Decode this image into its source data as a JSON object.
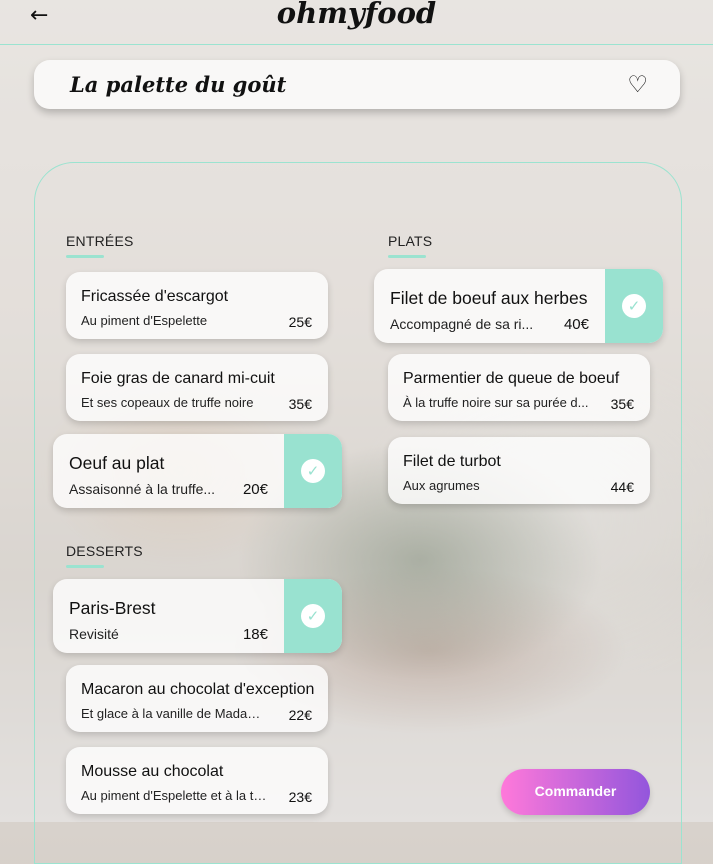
{
  "header": {
    "back_icon": "arrow-left-icon",
    "logo": "ohmyfood"
  },
  "restaurant": {
    "title": "La palette du goût",
    "favorite_icon": "heart-outline-icon"
  },
  "sections": {
    "starters": {
      "label": "ENTRÉES",
      "items": [
        {
          "name": "Fricassée d'escargot",
          "description": "Au piment d'Espelette",
          "price": "25€",
          "selected": false
        },
        {
          "name": "Foie gras de canard mi-cuit",
          "description": "Et ses copeaux de truffe noire",
          "price": "35€",
          "selected": false
        },
        {
          "name": "Oeuf au plat",
          "description": "Assaisonné à la truffe...",
          "price": "20€",
          "selected": true
        }
      ]
    },
    "mains": {
      "label": "PLATS",
      "items": [
        {
          "name": "Filet de boeuf aux herbes",
          "description": "Accompagné de sa ri...",
          "price": "40€",
          "selected": true
        },
        {
          "name": "Parmentier de queue de boeuf",
          "description": "À la truffe noire sur sa purée d...",
          "price": "35€",
          "selected": false
        },
        {
          "name": "Filet de turbot",
          "description": "Aux agrumes",
          "price": "44€",
          "selected": false
        }
      ]
    },
    "desserts": {
      "label": "DESSERTS",
      "items": [
        {
          "name": "Paris-Brest",
          "description": "Revisité",
          "price": "18€",
          "selected": true
        },
        {
          "name": "Macaron au chocolat d'exception",
          "description": "Et glace à la vanille de Madaga...",
          "price": "22€",
          "selected": false
        },
        {
          "name": "Mousse au chocolat",
          "description": "Au piment d'Espelette et à la tr...",
          "price": "23€",
          "selected": false
        }
      ]
    }
  },
  "check_icon": "checkmark-icon",
  "order_button": {
    "label": "Commander"
  },
  "colors": {
    "accent": "#99e2d0",
    "button_gradient_start": "#ff79da",
    "button_gradient_end": "#9356dc"
  }
}
